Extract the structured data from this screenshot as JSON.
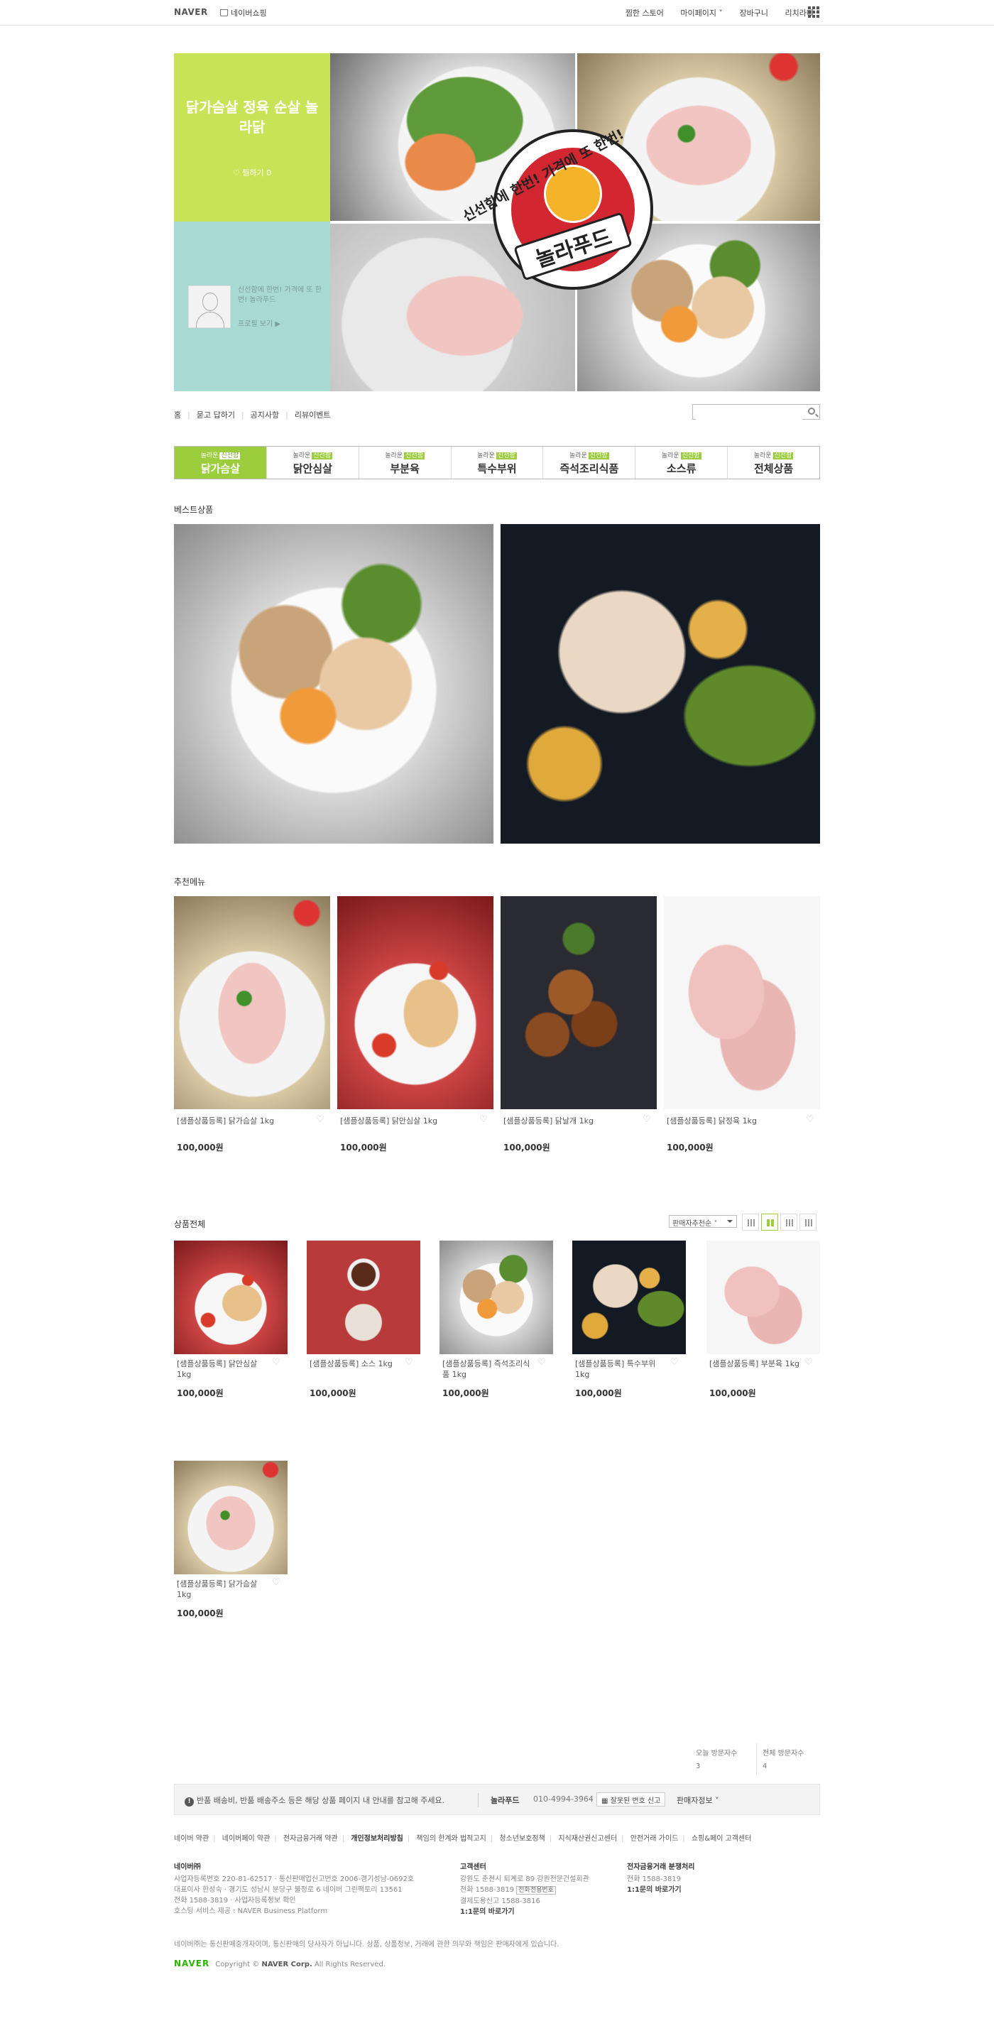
{
  "gnb": {
    "naver": "NAVER",
    "shopping": "네이버쇼핑",
    "menu": [
      "찜한 스토어",
      "마이페이지 ˅",
      "장바구니",
      "리치라떼 ˅"
    ]
  },
  "store": {
    "title": "닭가슴살 정육 순살 놀라닭",
    "like_label": "찜하기 0",
    "description": "신선함에 한번! 가격에 또 한번! 놀라푸드",
    "profile_link": "프로필 보기 ▶",
    "logo_slogan": "신선함에 한번! 가격에 또 한번!",
    "logo_brand": "놀라푸드"
  },
  "subnav": [
    "홈",
    "묻고 답하기",
    "공지사항",
    "리뷰이벤트"
  ],
  "search": {
    "placeholder": ""
  },
  "categories": [
    {
      "prefix": "놀라운",
      "tag": "신선함",
      "name": "닭가슴살",
      "active": true
    },
    {
      "prefix": "놀라운",
      "tag": "신선함",
      "name": "닭안심살",
      "active": false
    },
    {
      "prefix": "놀라운",
      "tag": "신선함",
      "name": "부분육",
      "active": false
    },
    {
      "prefix": "놀라운",
      "tag": "신선함",
      "name": "특수부위",
      "active": false
    },
    {
      "prefix": "놀라운",
      "tag": "신선함",
      "name": "즉석조리식품",
      "active": false
    },
    {
      "prefix": "놀라운",
      "tag": "신선함",
      "name": "소스류",
      "active": false
    },
    {
      "prefix": "놀라운",
      "tag": "신선함",
      "name": "전체상품",
      "active": false
    }
  ],
  "sections": {
    "best": "베스트상품",
    "recommended": "추천메뉴",
    "all": "상품전체"
  },
  "recommended": [
    {
      "name": "[샘플상품등록] 닭가슴살 1kg",
      "price": "100,000원"
    },
    {
      "name": "[샘플상품등록] 닭안심살 1kg",
      "price": "100,000원"
    },
    {
      "name": "[샘플상품등록] 닭날개 1kg",
      "price": "100,000원"
    },
    {
      "name": "[샘플상품등록] 닭정육 1kg",
      "price": "100,000원"
    }
  ],
  "sort": {
    "selected": "판매자추천순 ˅"
  },
  "all_products": [
    {
      "name": "[샘플상품등록] 닭안심살 1kg",
      "price": "100,000원"
    },
    {
      "name": "[샘플상품등록] 소스 1kg",
      "price": "100,000원"
    },
    {
      "name": "[샘플상품등록] 즉석조리식품 1kg",
      "price": "100,000원"
    },
    {
      "name": "[샘플상품등록] 특수부위 1kg",
      "price": "100,000원"
    },
    {
      "name": "[샘플상품등록] 부분육 1kg",
      "price": "100,000원"
    },
    {
      "name": "[샘플상품등록] 닭가슴살 1kg",
      "price": "100,000원"
    }
  ],
  "visitors": {
    "today_label": "오늘 방문자수",
    "today": "3",
    "total_label": "전체 방문자수",
    "total": "4"
  },
  "notice": {
    "text": "반품 배송비, 반품 배송주소 등은 해당 상품 페이지 내 안내를 참고해 주세요.",
    "shop": "놀라푸드",
    "phone": "010-4994-3964",
    "report": "잘못된 번호 신고",
    "seller_info": "판매자정보 ˅"
  },
  "footer": {
    "links": [
      "네이버 약관",
      "네이버페이 약관",
      "전자금융거래 약관",
      "개인정보처리방침",
      "책임의 한계와 법적고지",
      "청소년보호정책",
      "지식재산권신고센터",
      "안전거래 가이드",
      "쇼핑&페이 고객센터"
    ],
    "naver_head": "네이버㈜",
    "naver_lines": [
      "사업자등록번호 220-81-62517 · 통신판매업신고번호 2006-경기성남-0692호",
      "대표이사 한성숙 · 경기도 성남시 분당구 불정로 6 네이버 그린팩토리 13561",
      "전화 1588-3819 · 사업자등록정보 확인",
      "호스팅 서비스 제공 : NAVER Business Platform"
    ],
    "cs_head": "고객센터",
    "cs_lines": [
      "강원도 춘천시 퇴계로 89 강원전문건설회관",
      "전화 1588-3819",
      "결제도용신고 1588-3816"
    ],
    "cs_badge": "전화전용번호",
    "cs_link": "1:1문의 바로가기",
    "efin_head": "전자금융거래 분쟁처리",
    "efin_lines": [
      "전화 1588-3819"
    ],
    "efin_link": "1:1문의 바로가기",
    "disclaimer": "네이버㈜는 통신판매중개자이며, 통신판매의 당사자가 아닙니다. 상품, 상품정보, 거래에 관한 의무와 책임은 판매자에게 있습니다.",
    "copyright_logo": "NAVER",
    "copyright": "Copyright ©",
    "copyright_corp": "NAVER Corp.",
    "copyright_tail": "All Rights Reserved."
  },
  "colors": {
    "accent": "#9bcd3c",
    "hero_green": "#c9e357",
    "hero_teal": "#a9d9d3",
    "naver_green": "#2db400"
  }
}
